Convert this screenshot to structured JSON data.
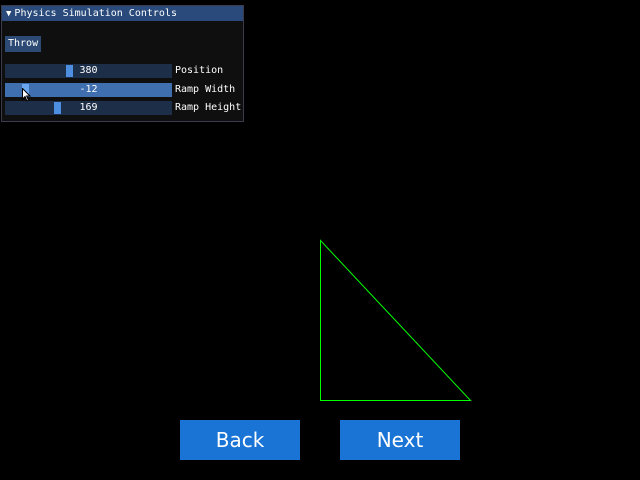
{
  "panel": {
    "title": "Physics Simulation Controls",
    "throw_label": "Throw",
    "sliders": [
      {
        "value": "380",
        "label": "Position",
        "level": 0.38
      },
      {
        "value": "-12",
        "label": "Ramp Width",
        "level": 0.08
      },
      {
        "value": "169",
        "label": "Ramp Height",
        "level": 0.3
      }
    ]
  },
  "buttons": {
    "back_label": "Back",
    "next_label": "Next"
  },
  "colors": {
    "panel_header": "#294a7a",
    "slider_bg": "#1d2e48",
    "slider_active": "#3f6fae",
    "slider_thumb": "#4d8ee0",
    "triangle_stroke": "#00ff00",
    "nav_button": "#1a74d6"
  }
}
